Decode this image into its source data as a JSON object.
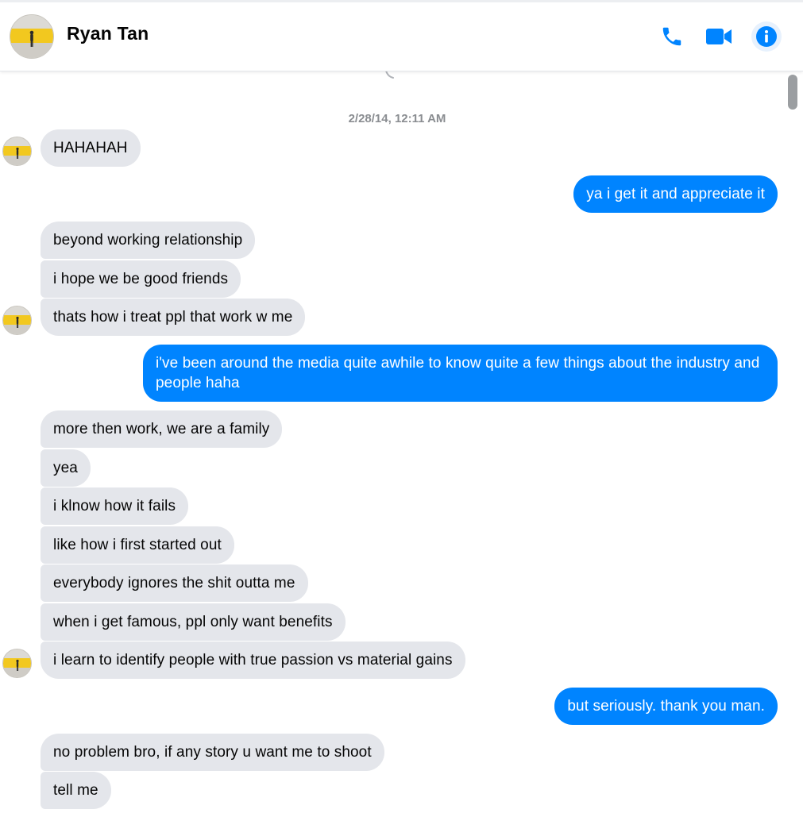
{
  "header": {
    "contact_name": "Ryan Tan",
    "avatar_icon": "profile-photo-icon",
    "actions": [
      {
        "name": "call",
        "icon": "phone-icon"
      },
      {
        "name": "video-call",
        "icon": "video-camera-icon"
      },
      {
        "name": "conversation-info",
        "icon": "info-icon"
      }
    ]
  },
  "colors": {
    "accent": "#0084ff",
    "incoming_bubble": "#e4e6eb",
    "timestamp": "#8a8d91"
  },
  "conversation": {
    "timestamp": "2/28/14, 12:11 AM",
    "messages": [
      {
        "from": "them",
        "text": "HAHAHAH"
      },
      {
        "from": "me",
        "text": "ya i get it and appreciate it"
      },
      {
        "from": "them",
        "text": "beyond working relationship"
      },
      {
        "from": "them",
        "text": "i hope we be good friends"
      },
      {
        "from": "them",
        "text": "thats how i treat ppl that work w me"
      },
      {
        "from": "me",
        "text": "i've been around the media quite awhile to know quite a few things about the industry and people haha"
      },
      {
        "from": "them",
        "text": "more then work, we are a family"
      },
      {
        "from": "them",
        "text": "yea"
      },
      {
        "from": "them",
        "text": "i klnow how it fails"
      },
      {
        "from": "them",
        "text": "like how i first started out"
      },
      {
        "from": "them",
        "text": "everybody ignores the shit outta me"
      },
      {
        "from": "them",
        "text": "when i get famous, ppl only want benefits"
      },
      {
        "from": "them",
        "text": "i learn to identify people with true passion vs material gains"
      },
      {
        "from": "me",
        "text": "but seriously. thank you man."
      },
      {
        "from": "them",
        "text": "no problem bro, if any story u want me to shoot"
      },
      {
        "from": "them",
        "text": "tell me"
      }
    ]
  }
}
